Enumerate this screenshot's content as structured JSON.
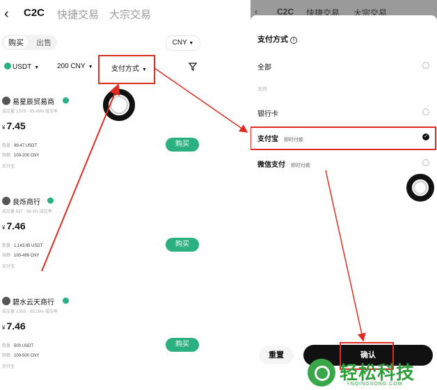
{
  "left": {
    "back_icon": "chevron-left-icon",
    "tabs": [
      "C2C",
      "快捷交易",
      "大宗交易"
    ],
    "segment": {
      "buy": "购买",
      "sell": "出售"
    },
    "currency": "CNY",
    "filters": {
      "coin": "USDT",
      "amount": "200 CNY",
      "payment": "支付方式"
    },
    "merchants": [
      {
        "name": "易星辰贸易商",
        "stats": "成交量 1,978 · 99.49% 成交率",
        "price_symbol": "¥",
        "price": "7.45",
        "qty_label": "数量",
        "qty": "99.47 USDT",
        "limit_label": "限额",
        "limit": "100-200 CNY",
        "pay": "支付宝",
        "buy": "购买"
      },
      {
        "name": "良烁商行",
        "stats": "成交量 697 · 98.3% 成交率",
        "price_symbol": "¥",
        "price": "7.46",
        "qty_label": "数量",
        "qty": "1,143.95 USDT",
        "limit_label": "限额",
        "limit": "100-499 CNY",
        "pay": "支付宝",
        "buy": "购买"
      },
      {
        "name": "碧水云天商行",
        "stats": "成交量 2,956 · 99.29% 成交率",
        "price_symbol": "¥",
        "price": "7.46",
        "qty_label": "数量",
        "qty": "500 USDT",
        "limit_label": "限额",
        "limit": "100-500 CNY",
        "pay": "支付宝",
        "buy": "购买"
      }
    ]
  },
  "right": {
    "dim_tabs": [
      "C2C",
      "快捷交易",
      "大宗交易"
    ],
    "title": "支付方式",
    "options": [
      {
        "label": "全部",
        "sub": "",
        "checked": false
      },
      {
        "label": "银行卡",
        "sub": "",
        "checked": false
      },
      {
        "label": "支付宝",
        "sub": "即时付款",
        "checked": true
      },
      {
        "label": "微信支付",
        "sub": "即时付款",
        "checked": false
      }
    ],
    "other_label": "其他",
    "reset": "重置",
    "confirm": "确认"
  },
  "watermark": {
    "text": "轻松科技",
    "sub": "YNQINGSONG.COM"
  },
  "colors": {
    "accent": "#2bb07f",
    "annotation": "#e02b20",
    "primary": "#111111"
  }
}
